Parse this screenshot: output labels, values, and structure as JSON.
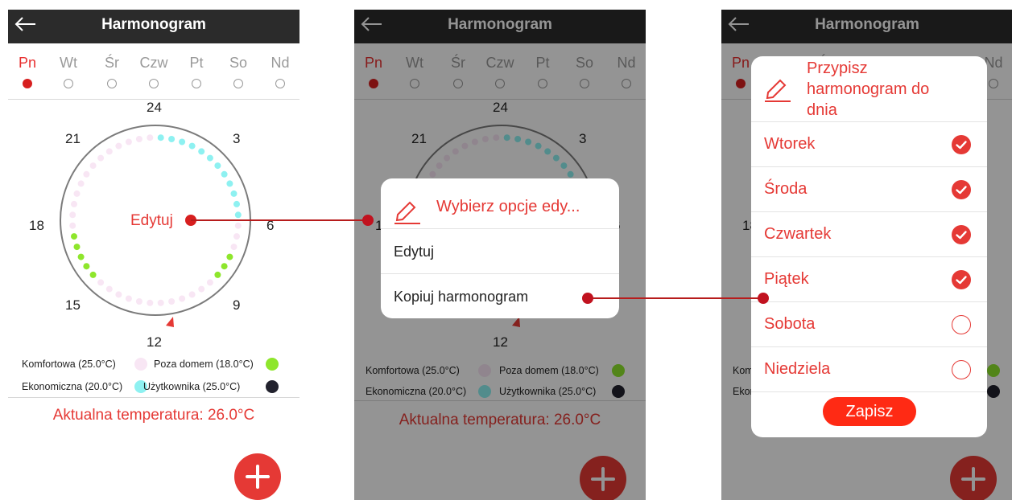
{
  "header": {
    "title": "Harmonogram"
  },
  "days": [
    {
      "label": "Pn",
      "active": true
    },
    {
      "label": "Wt",
      "active": false
    },
    {
      "label": "Śr",
      "active": false
    },
    {
      "label": "Czw",
      "active": false
    },
    {
      "label": "Pt",
      "active": false
    },
    {
      "label": "So",
      "active": false
    },
    {
      "label": "Nd",
      "active": false
    }
  ],
  "clock": {
    "hour_labels": [
      "24",
      "3",
      "6",
      "9",
      "12",
      "15",
      "18",
      "21"
    ],
    "edit_label": "Edytuj"
  },
  "legend": {
    "komfortowa": "Komfortowa (25.0°C)",
    "poza_domem": "Poza domem (18.0°C)",
    "ekonomiczna": "Ekonomiczna (20.0°C)",
    "uzytkownika": "Użytkownika (25.0°C)"
  },
  "colors": {
    "accent": "#e53935",
    "komfortowa": "#f8e6f4",
    "poza_domem": "#8ee62c",
    "ekonomiczna": "#8ef1f1",
    "uzytkownika": "#22222e",
    "header": "#2b2b2b"
  },
  "current_temp": "Aktualna temperatura: 26.0°C",
  "edit_dialog": {
    "title": "Wybierz opcje edy...",
    "options": [
      "Edytuj",
      "Kopiuj harmonogram"
    ]
  },
  "assign_dialog": {
    "title": "Przypisz harmonogram do dnia",
    "title_lines": [
      "Przypisz",
      "harmonogram do",
      "dnia"
    ],
    "days": [
      {
        "label": "Wtorek",
        "checked": true
      },
      {
        "label": "Środa",
        "checked": true
      },
      {
        "label": "Czwartek",
        "checked": true
      },
      {
        "label": "Piątek",
        "checked": true
      },
      {
        "label": "Sobota",
        "checked": false
      },
      {
        "label": "Niedziela",
        "checked": false
      }
    ],
    "save_label": "Zapisz"
  },
  "icons": {
    "back": "back-arrow-icon",
    "edit": "pencil-icon",
    "fab": "plus-icon",
    "check_on": "check-circle-icon",
    "check_off": "empty-circle-icon"
  }
}
